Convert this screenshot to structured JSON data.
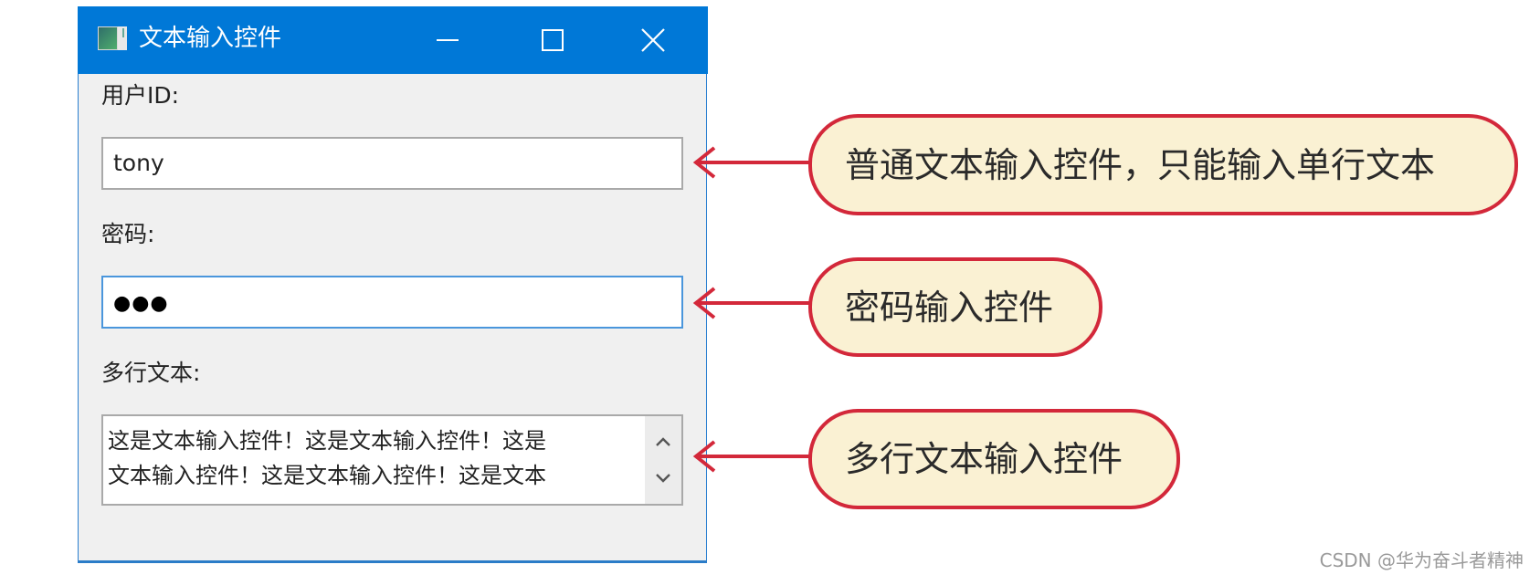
{
  "window": {
    "title": "文本输入控件",
    "icon": "app-window-icon",
    "controls": {
      "minimize": "minimize-icon",
      "maximize": "maximize-icon",
      "close": "close-icon"
    },
    "accent_color": "#0078d7"
  },
  "form": {
    "user_id": {
      "label": "用户ID:",
      "value": "tony"
    },
    "password": {
      "label": "密码:",
      "masked_value": "●●●",
      "char_count": 3
    },
    "multiline": {
      "label": "多行文本:",
      "lines": [
        "这是文本输入控件！这是文本输入控件！这是",
        "文本输入控件！这是文本输入控件！这是文本"
      ],
      "scroll_up": "chevron-up-icon",
      "scroll_down": "chevron-down-icon"
    }
  },
  "annotations": [
    {
      "text": "普通文本输入控件，只能输入单行文本",
      "target": "user_id"
    },
    {
      "text": "密码输入控件",
      "target": "password"
    },
    {
      "text": "多行文本输入控件",
      "target": "multiline"
    }
  ],
  "annotation_colors": {
    "border": "#d3283a",
    "fill": "#faf1d3"
  },
  "watermark": "CSDN @华为奋斗者精神"
}
